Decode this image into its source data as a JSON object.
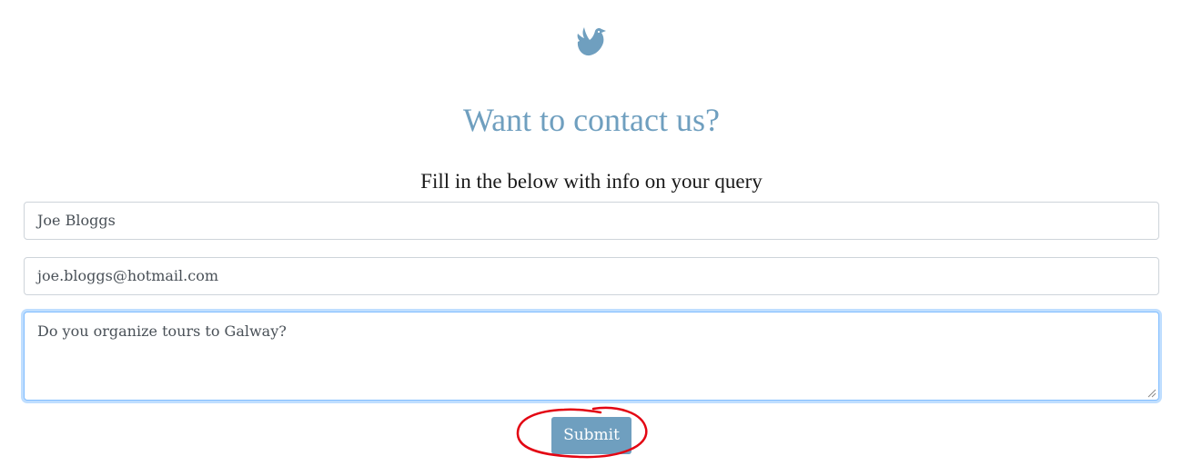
{
  "logo": {
    "icon": "bird-icon",
    "color": "#6f9fbf"
  },
  "heading": "Want to contact us?",
  "subheading": "Fill in the below with info on your query",
  "form": {
    "name_value": "Joe Bloggs",
    "email_value": "joe.bloggs@hotmail.com",
    "message_value": "Do you organize tours to Galway?",
    "submit_label": "Submit"
  },
  "colors": {
    "accent": "#6f9fbf",
    "annotation": "#e30613"
  }
}
